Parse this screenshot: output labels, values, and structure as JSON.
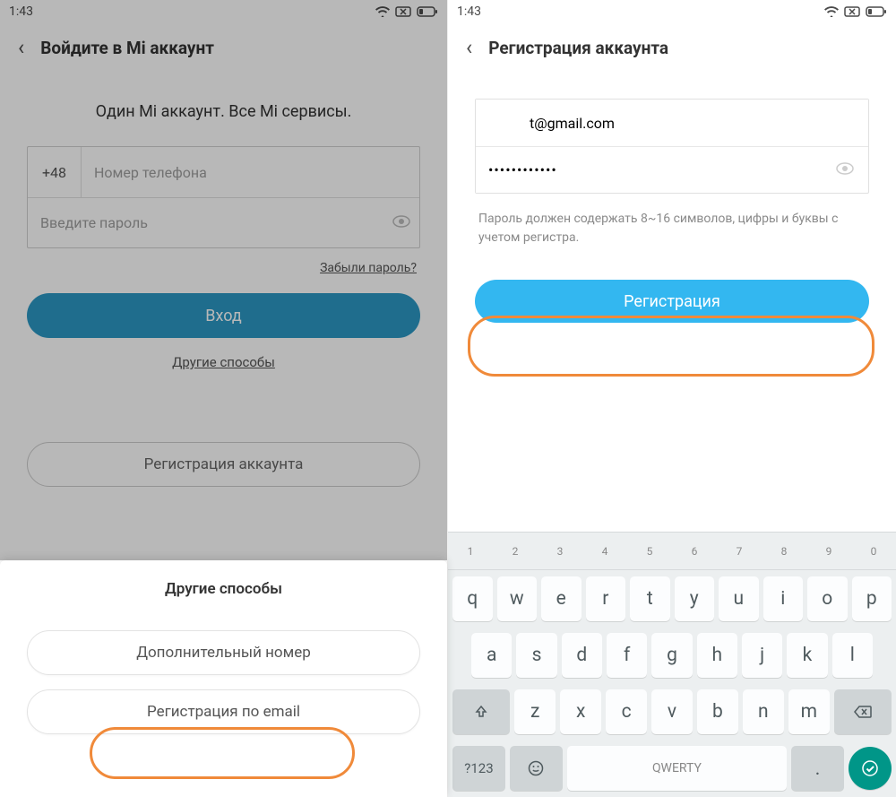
{
  "status": {
    "time": "1:43"
  },
  "left": {
    "title": "Войдите в Mi аккаунт",
    "slogan": "Один Mi аккаунт. Все Mi сервисы.",
    "prefix": "+48",
    "phone_placeholder": "Номер телефона",
    "pwd_placeholder": "Введите пароль",
    "forgot": "Забыли пароль?",
    "login_btn": "Вход",
    "other_ways_link": "Другие способы",
    "register_account": "Регистрация аккаунта",
    "sheet": {
      "title": "Другие способы",
      "alt_number": "Дополнительный номер",
      "email_register": "Регистрация по email"
    }
  },
  "right": {
    "title": "Регистрация аккаунта",
    "email_value": "t@gmail.com",
    "pwd_value": "••••••••••••",
    "hint": "Пароль должен содержать 8~16 символов, цифры и буквы с учетом регистра.",
    "register_btn": "Регистрация"
  },
  "kbd": {
    "hints": [
      "1",
      "2",
      "3",
      "4",
      "5",
      "6",
      "7",
      "8",
      "9",
      "0"
    ],
    "row1": [
      "q",
      "w",
      "e",
      "r",
      "t",
      "y",
      "u",
      "i",
      "o",
      "p"
    ],
    "row2": [
      "a",
      "s",
      "d",
      "f",
      "g",
      "h",
      "j",
      "k",
      "l"
    ],
    "row3": [
      "z",
      "x",
      "c",
      "v",
      "b",
      "n",
      "m"
    ],
    "fn": "?123",
    "space": "QWERTY"
  }
}
